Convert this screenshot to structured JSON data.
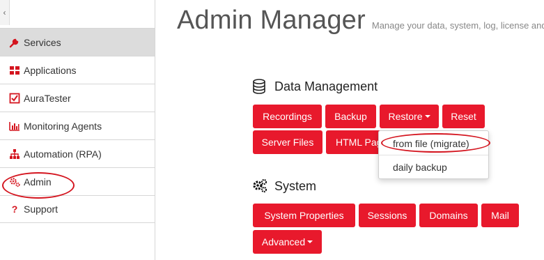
{
  "sidebar": {
    "collapse_glyph": "‹",
    "items": [
      {
        "label": "Services",
        "icon": "wrench-icon",
        "active": true
      },
      {
        "label": "Applications",
        "icon": "grid-icon",
        "active": false
      },
      {
        "label": "AuraTester",
        "icon": "checkbox-icon",
        "active": false
      },
      {
        "label": "Monitoring Agents",
        "icon": "bar-chart-icon",
        "active": false
      },
      {
        "label": "Automation (RPA)",
        "icon": "sitemap-icon",
        "active": false
      },
      {
        "label": "Admin",
        "icon": "gears-icon",
        "active": false
      },
      {
        "label": "Support",
        "icon": "question-icon",
        "active": false
      }
    ]
  },
  "header": {
    "title": "Admin Manager",
    "subtitle": "Manage your data, system, log, license and"
  },
  "data_management": {
    "title": "Data Management",
    "buttons": {
      "recordings": "Recordings",
      "backup": "Backup",
      "restore": "Restore",
      "reset": "Reset",
      "server_files": "Server Files",
      "html_pages": "HTML Pag"
    },
    "restore_menu": {
      "from_file": "from file (migrate)",
      "daily_backup": "daily backup"
    }
  },
  "system": {
    "title": "System",
    "buttons": {
      "system_properties": "System Properties",
      "sessions": "Sessions",
      "domains": "Domains",
      "mail": "Mail",
      "advanced": "Advanced"
    }
  },
  "colors": {
    "accent": "#e8192c",
    "icon_red": "#d4151f",
    "highlight_oval": "#d4151f",
    "active_bg": "#dcdcdc"
  }
}
